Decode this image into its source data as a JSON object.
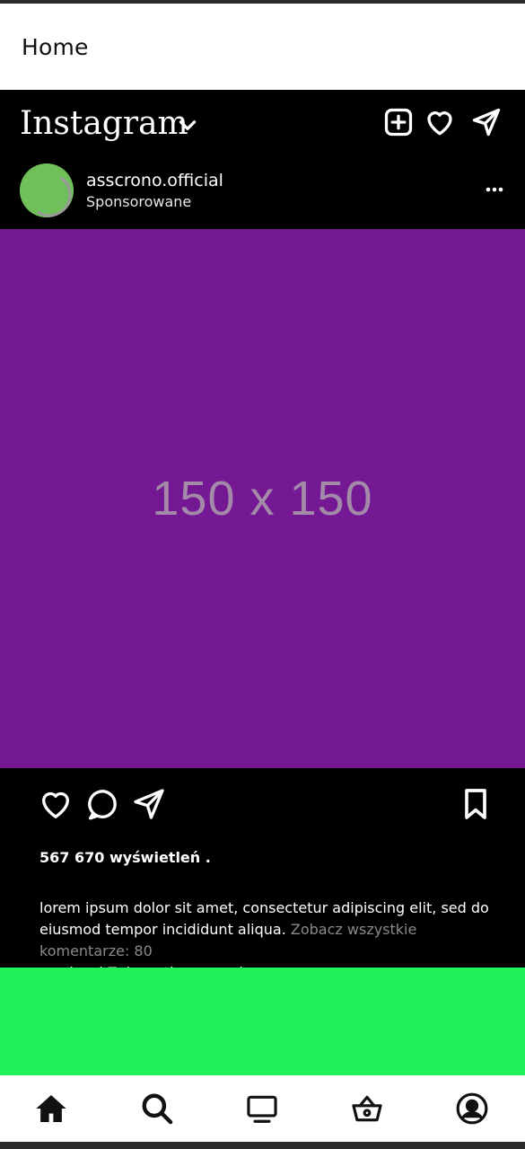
{
  "header": {
    "title": "Home"
  },
  "instagram": {
    "logo_text": "Instagram"
  },
  "post": {
    "username": "asscrono.official",
    "sponsored_label": "Sponsorowane",
    "media_placeholder": "150 x 150",
    "views": "567 670 wyświetleń .",
    "caption_text": "lorem ipsum dolor sit amet, consectetur adipiscing elit, sed do eiusmod tempor incididunt aliqua.",
    "view_comments": " Zobacz wszystkie komentarze: 80",
    "more_and_translate": " ... więcej Zobacz tłumaczenie."
  },
  "colors": {
    "media_bg": "#751894",
    "accent_green": "#22f25a",
    "avatar_green": "#6fbf5a"
  },
  "icons": {
    "top_bar": [
      "chevron-down-icon",
      "add-post-icon",
      "heart-icon",
      "send-icon"
    ],
    "post_actions": [
      "heart-icon",
      "comment-icon",
      "share-icon",
      "bookmark-icon"
    ],
    "tab_bar": [
      "home-icon",
      "search-icon",
      "tv-icon",
      "basket-icon",
      "profile-icon"
    ]
  }
}
